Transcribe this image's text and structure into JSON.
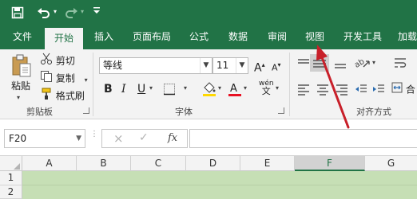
{
  "quick_access": {
    "icons": [
      "save-icon",
      "undo-icon",
      "redo-icon",
      "customize-icon"
    ]
  },
  "tabs": [
    {
      "label": "文件"
    },
    {
      "label": "开始",
      "active": true
    },
    {
      "label": "插入"
    },
    {
      "label": "页面布局"
    },
    {
      "label": "公式"
    },
    {
      "label": "数据"
    },
    {
      "label": "审阅"
    },
    {
      "label": "视图"
    },
    {
      "label": "开发工具"
    },
    {
      "label": "加载"
    }
  ],
  "clipboard": {
    "paste": "粘贴",
    "cut": "剪切",
    "copy": "复制",
    "format_painter": "格式刷",
    "group_label": "剪贴板"
  },
  "font": {
    "name": "等线",
    "size": "11",
    "bold": "B",
    "italic": "I",
    "underline": "U",
    "increase": "A",
    "decrease": "A",
    "wen": "wén",
    "group_label": "字体"
  },
  "alignment": {
    "merge_label": "合",
    "group_label": "对齐方式"
  },
  "formula_bar": {
    "name_box": "F20",
    "cancel": "×",
    "enter": "✓",
    "fx": "fx",
    "formula_value": ""
  },
  "grid": {
    "columns": [
      "A",
      "B",
      "C",
      "D",
      "E",
      "F",
      "G"
    ],
    "selected_column": "F",
    "rows": [
      "1",
      "2"
    ]
  },
  "colors": {
    "excel_green": "#217346",
    "arrow_red": "#c8202a",
    "cell_fill": "#c6dfb5",
    "font_color_bar": "#e81123",
    "fill_color_bar": "#ffd800"
  }
}
